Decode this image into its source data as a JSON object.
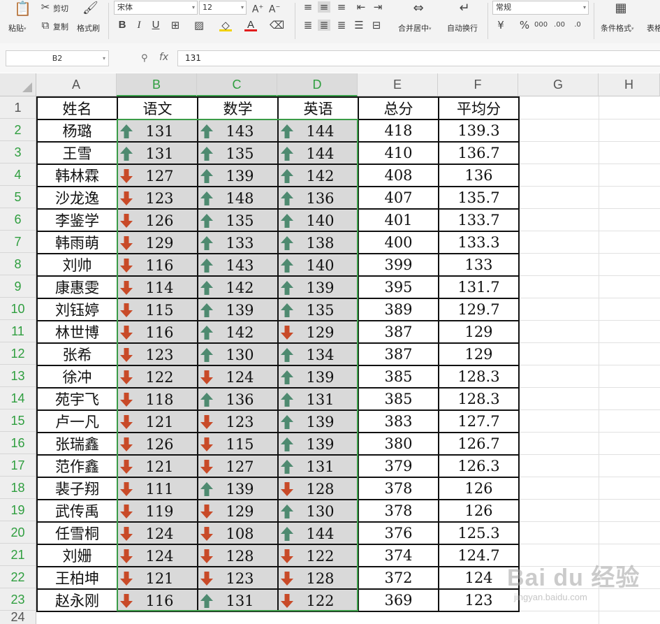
{
  "ribbon": {
    "paste": "粘贴",
    "cut": "剪切",
    "copy": "复制",
    "format_painter": "格式刷",
    "font_name": "宋体",
    "font_size": "12",
    "merge_center": "合并居中",
    "wrap_text": "自动换行",
    "number_format": "常规",
    "conditional_format": "条件格式",
    "table_style": "表格"
  },
  "formula_bar": {
    "name_box": "B2",
    "fx": "fx",
    "value": "131"
  },
  "columns": [
    "A",
    "B",
    "C",
    "D",
    "E",
    "F",
    "G",
    "H"
  ],
  "row_numbers": [
    "1",
    "2",
    "3",
    "4",
    "5",
    "6",
    "7",
    "8",
    "9",
    "10",
    "11",
    "12",
    "13",
    "14",
    "15",
    "16",
    "17",
    "18",
    "19",
    "20",
    "21",
    "22",
    "23"
  ],
  "row24": "24",
  "headers": {
    "name": "姓名",
    "chinese": "语文",
    "math": "数学",
    "english": "英语",
    "total": "总分",
    "average": "平均分"
  },
  "rows": [
    {
      "name": "杨璐",
      "chinese": "131",
      "math": "143",
      "english": "144",
      "total": "418",
      "average": "139.3"
    },
    {
      "name": "王雪",
      "chinese": "131",
      "math": "135",
      "english": "144",
      "total": "410",
      "average": "136.7"
    },
    {
      "name": "韩林霖",
      "chinese": "127",
      "math": "139",
      "english": "142",
      "total": "408",
      "average": "136"
    },
    {
      "name": "沙龙逸",
      "chinese": "123",
      "math": "148",
      "english": "136",
      "total": "407",
      "average": "135.7"
    },
    {
      "name": "李鉴学",
      "chinese": "126",
      "math": "135",
      "english": "140",
      "total": "401",
      "average": "133.7"
    },
    {
      "name": "韩雨萌",
      "chinese": "129",
      "math": "133",
      "english": "138",
      "total": "400",
      "average": "133.3"
    },
    {
      "name": "刘帅",
      "chinese": "116",
      "math": "143",
      "english": "140",
      "total": "399",
      "average": "133"
    },
    {
      "name": "康惠雯",
      "chinese": "114",
      "math": "142",
      "english": "139",
      "total": "395",
      "average": "131.7"
    },
    {
      "name": "刘钰婷",
      "chinese": "115",
      "math": "139",
      "english": "135",
      "total": "389",
      "average": "129.7"
    },
    {
      "name": "林世博",
      "chinese": "116",
      "math": "142",
      "english": "129",
      "total": "387",
      "average": "129"
    },
    {
      "name": "张希",
      "chinese": "123",
      "math": "130",
      "english": "134",
      "total": "387",
      "average": "129"
    },
    {
      "name": "徐冲",
      "chinese": "122",
      "math": "124",
      "english": "139",
      "total": "385",
      "average": "128.3"
    },
    {
      "name": "苑宇飞",
      "chinese": "118",
      "math": "136",
      "english": "131",
      "total": "385",
      "average": "128.3"
    },
    {
      "name": "卢一凡",
      "chinese": "121",
      "math": "123",
      "english": "139",
      "total": "383",
      "average": "127.7"
    },
    {
      "name": "张瑞鑫",
      "chinese": "126",
      "math": "115",
      "english": "139",
      "total": "380",
      "average": "126.7"
    },
    {
      "name": "范作鑫",
      "chinese": "121",
      "math": "127",
      "english": "131",
      "total": "379",
      "average": "126.3"
    },
    {
      "name": "裴子翔",
      "chinese": "111",
      "math": "139",
      "english": "128",
      "total": "378",
      "average": "126"
    },
    {
      "name": "武传禹",
      "chinese": "119",
      "math": "129",
      "english": "130",
      "total": "378",
      "average": "126"
    },
    {
      "name": "任雪桐",
      "chinese": "124",
      "math": "108",
      "english": "144",
      "total": "376",
      "average": "125.3"
    },
    {
      "name": "刘姗",
      "chinese": "124",
      "math": "128",
      "english": "122",
      "total": "374",
      "average": "124.7"
    },
    {
      "name": "王柏坤",
      "chinese": "121",
      "math": "123",
      "english": "128",
      "total": "372",
      "average": "124"
    },
    {
      "name": "赵永刚",
      "chinese": "116",
      "math": "131",
      "english": "122",
      "total": "369",
      "average": "123"
    }
  ],
  "arrows": {
    "chinese": [
      "up",
      "up",
      "down",
      "down",
      "down",
      "down",
      "down",
      "down",
      "down",
      "down",
      "down",
      "down",
      "down",
      "down",
      "down",
      "down",
      "down",
      "down",
      "down",
      "down",
      "down",
      "down"
    ],
    "math": [
      "up",
      "up",
      "up",
      "up",
      "up",
      "up",
      "up",
      "up",
      "up",
      "up",
      "up",
      "down",
      "up",
      "down",
      "down",
      "down",
      "up",
      "down",
      "down",
      "down",
      "down",
      "up"
    ],
    "english": [
      "up",
      "up",
      "up",
      "up",
      "up",
      "up",
      "up",
      "up",
      "up",
      "down",
      "up",
      "up",
      "up",
      "up",
      "up",
      "up",
      "down",
      "up",
      "up",
      "down",
      "down",
      "down"
    ]
  },
  "arrow_icons": {
    "up": "green-up-arrow-icon",
    "down": "red-down-arrow-icon"
  },
  "colors": {
    "up_arrow": "#4e8a70",
    "down_arrow": "#c84a28",
    "selection": "#3a9b47"
  },
  "watermark": {
    "brand": "Bai du 经验",
    "url": "jingyan.baidu.com"
  }
}
